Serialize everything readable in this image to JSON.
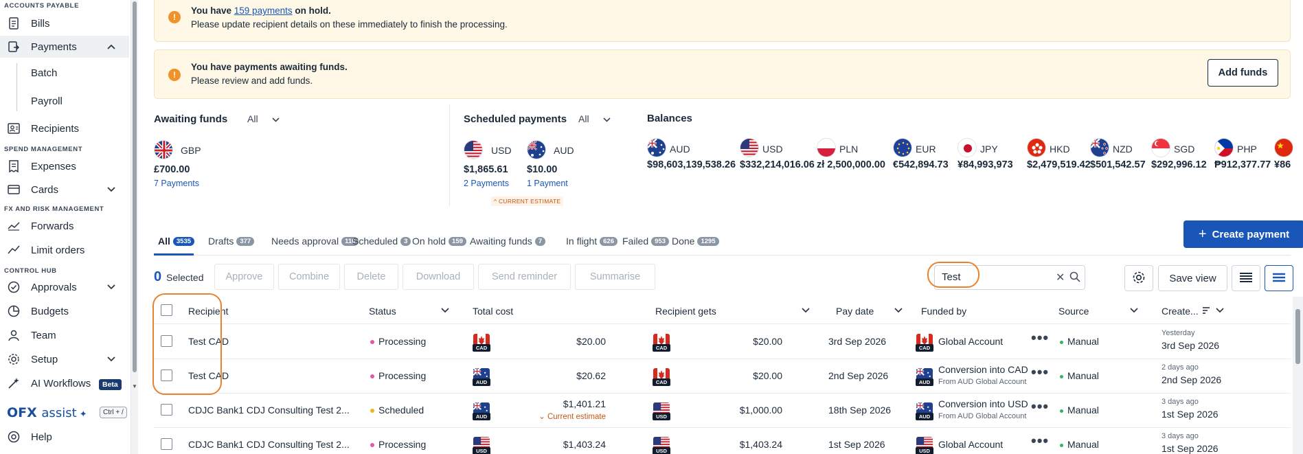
{
  "sidebar": {
    "sections": [
      "ACCOUNTS PAYABLE",
      "SPEND MANAGEMENT",
      "FX AND RISK MANAGEMENT",
      "CONTROL HUB"
    ],
    "items": {
      "bills": "Bills",
      "payments": "Payments",
      "batch": "Batch",
      "payroll": "Payroll",
      "recipients": "Recipients",
      "expenses": "Expenses",
      "cards": "Cards",
      "forwards": "Forwards",
      "limit_orders": "Limit orders",
      "approvals": "Approvals",
      "budgets": "Budgets",
      "team": "Team",
      "setup": "Setup",
      "ai_workflows": "AI Workflows",
      "help": "Help"
    },
    "beta_badge": "Beta",
    "assist_brand": "OFX",
    "assist_word": "assist",
    "shortcut": "Ctrl + /"
  },
  "banners": {
    "hold_prefix": "You have ",
    "hold_link": "159 payments",
    "hold_suffix": " on hold.",
    "hold_detail": "Please update recipient details on these immediately to finish the processing.",
    "funds_title": "You have payments awaiting funds.",
    "funds_detail": "Please review and add funds.",
    "add_funds_button": "Add funds"
  },
  "awaiting_funds": {
    "title": "Awaiting funds",
    "filter": "All",
    "items": [
      {
        "currency": "GBP",
        "amount": "£700.00",
        "link": "7 Payments"
      }
    ]
  },
  "scheduled_payments": {
    "title": "Scheduled payments",
    "filter": "All",
    "items": [
      {
        "currency": "USD",
        "amount": "$1,865.61",
        "link": "2 Payments"
      },
      {
        "currency": "AUD",
        "amount": "$10.00",
        "link": "1 Payment"
      }
    ],
    "estimate_badge": "CURRENT ESTIMATE"
  },
  "balances": {
    "title": "Balances",
    "items": [
      {
        "currency": "AUD",
        "amount": "$98,603,139,538.26"
      },
      {
        "currency": "USD",
        "amount": "$332,214,016.06"
      },
      {
        "currency": "PLN",
        "amount": "zł 2,500,000.00"
      },
      {
        "currency": "EUR",
        "amount": "€542,894.73"
      },
      {
        "currency": "JPY",
        "amount": "¥84,993,973"
      },
      {
        "currency": "HKD",
        "amount": "$2,479,519.42"
      },
      {
        "currency": "NZD",
        "amount": "$501,542.57"
      },
      {
        "currency": "SGD",
        "amount": "$292,996.12"
      },
      {
        "currency": "PHP",
        "amount": "₱912,377.77"
      },
      {
        "currency": "",
        "amount": "¥86"
      }
    ]
  },
  "tabs": [
    {
      "label": "All",
      "count": "3535"
    },
    {
      "label": "Drafts",
      "count": "377"
    },
    {
      "label": "Needs approval",
      "count": "110"
    },
    {
      "label": "Scheduled",
      "count": "3"
    },
    {
      "label": "On hold",
      "count": "159"
    },
    {
      "label": "Awaiting funds",
      "count": "7"
    },
    {
      "label": "In flight",
      "count": "626"
    },
    {
      "label": "Failed",
      "count": "953"
    },
    {
      "label": "Done",
      "count": "1295"
    }
  ],
  "create_payment": "Create payment",
  "toolbar": {
    "selected_count": "0",
    "selected_label": "Selected",
    "approve": "Approve",
    "combine": "Combine",
    "delete": "Delete",
    "download": "Download",
    "send_reminder": "Send reminder",
    "summarise": "Summarise",
    "search_value": "Test",
    "save_view": "Save view"
  },
  "table": {
    "headers": {
      "recipient": "Recipient",
      "status": "Status",
      "total_cost": "Total cost",
      "recipient_gets": "Recipient gets",
      "pay_date": "Pay date",
      "funded_by": "Funded by",
      "source": "Source",
      "created": "Create..."
    },
    "rows": [
      {
        "recipient": "Test CAD",
        "status": "Processing",
        "status_color": "#e05c9e",
        "cost_ccy": "CAD",
        "total_cost": "$20.00",
        "cost_note": "",
        "gets_ccy": "CAD",
        "recipient_gets": "$20.00",
        "pay_date": "3rd Sep 2026",
        "fund_ccy": "CAD",
        "funded_by": "Global Account",
        "funded_sub": "",
        "source": "Manual",
        "created_rel": "Yesterday",
        "created": "3rd Sep 2026"
      },
      {
        "recipient": "Test CAD",
        "status": "Processing",
        "status_color": "#e05c9e",
        "cost_ccy": "AUD",
        "total_cost": "$20.62",
        "cost_note": "",
        "gets_ccy": "CAD",
        "recipient_gets": "$20.00",
        "pay_date": "2nd Sep 2026",
        "fund_ccy": "AUD",
        "funded_by": "Conversion into CAD",
        "funded_sub": "From AUD Global Account",
        "source": "Manual",
        "created_rel": "2 days ago",
        "created": "2nd Sep 2026"
      },
      {
        "recipient": "CDJC Bank1 CDJ Consulting Test 2...",
        "status": "Scheduled",
        "status_color": "#e8b81e",
        "cost_ccy": "AUD",
        "total_cost": "$1,401.21",
        "cost_note": "Current estimate",
        "gets_ccy": "USD",
        "recipient_gets": "$1,000.00",
        "pay_date": "18th Sep 2026",
        "fund_ccy": "AUD",
        "funded_by": "Conversion into USD",
        "funded_sub": "From AUD Global Account",
        "source": "Manual",
        "created_rel": "3 days ago",
        "created": "1st Sep 2026"
      },
      {
        "recipient": "CDJC Bank1 CDJ Consulting Test 2...",
        "status": "Processing",
        "status_color": "#e05c9e",
        "cost_ccy": "USD",
        "total_cost": "$1,403.24",
        "cost_note": "",
        "gets_ccy": "USD",
        "recipient_gets": "$1,403.24",
        "pay_date": "1st Sep 2026",
        "fund_ccy": "USD",
        "funded_by": "Global Account",
        "funded_sub": "",
        "source": "Manual",
        "created_rel": "3 days ago",
        "created": "1st Sep 2026"
      }
    ]
  },
  "colors": {
    "primary": "#1a56b8",
    "warning": "#f0922a",
    "highlight": "#e8822e",
    "source_dot": "#2fb36b"
  }
}
